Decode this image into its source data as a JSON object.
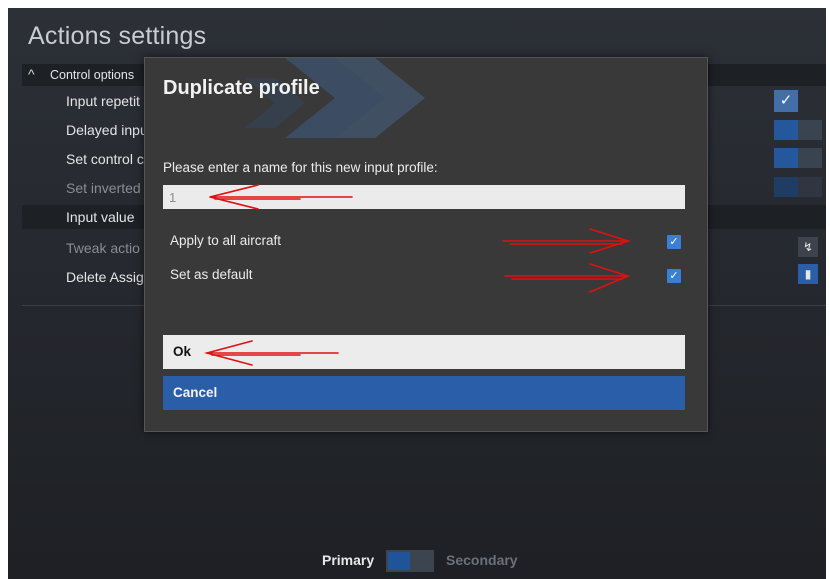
{
  "background": {
    "title": "Actions settings",
    "section_header": "Control options",
    "rows": [
      {
        "label": "Input repetit",
        "dim": false
      },
      {
        "label": "Delayed inpu",
        "dim": false
      },
      {
        "label": "Set control c",
        "dim": false
      },
      {
        "label": "Set inverted",
        "dim": true
      },
      {
        "label": "Input value",
        "dim": false
      },
      {
        "label": "Tweak actio",
        "dim": true
      },
      {
        "label": "Delete Assig",
        "dim": false
      }
    ],
    "bottom_toggle": {
      "primary": "Primary",
      "secondary": "Secondary"
    }
  },
  "dialog": {
    "title": "Duplicate profile",
    "prompt": "Please enter a name for this new input profile:",
    "name_value": "1",
    "apply_all": {
      "label": "Apply to all aircraft",
      "checked": true
    },
    "set_default": {
      "label": "Set as default",
      "checked": true
    },
    "ok_label": "Ok",
    "cancel_label": "Cancel"
  },
  "colors": {
    "accent": "#2a5ea8",
    "checkbox": "#3a7fd6",
    "annotation_arrow": "#e01010"
  },
  "icons": [
    "chevron-up-icon",
    "checkmark-icon",
    "tweak-curve-icon",
    "trash-icon"
  ]
}
